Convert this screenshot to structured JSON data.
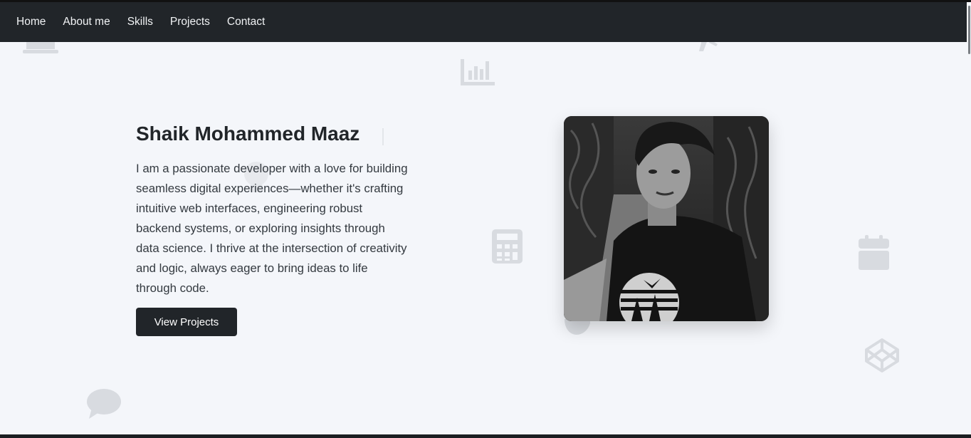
{
  "nav": {
    "links": [
      "Home",
      "About me",
      "Skills",
      "Projects",
      "Contact"
    ]
  },
  "hero": {
    "name": "Shaik Mohammed Maaz",
    "description": "I am a passionate developer with a love for building seamless digital experiences—whether it's crafting intuitive web interfaces, engineering robust backend systems, or exploring insights through data science. I thrive at the intersection of creativity and logic, always eager to bring ideas to life through code.",
    "button_label": "View Projects"
  },
  "background_icons": [
    "laptop-icon",
    "bar-chart-icon",
    "code-icon",
    "calculator-icon",
    "calendar-icon",
    "codepen-icon",
    "chat-bubble-icon",
    "apple-icon",
    "lightbulb-icon"
  ],
  "colors": {
    "navbar_bg": "#212529",
    "page_bg": "#f4f6fa",
    "text_dark": "#212529",
    "button_bg": "#212529",
    "icon_gray": "#d8dbe0"
  }
}
